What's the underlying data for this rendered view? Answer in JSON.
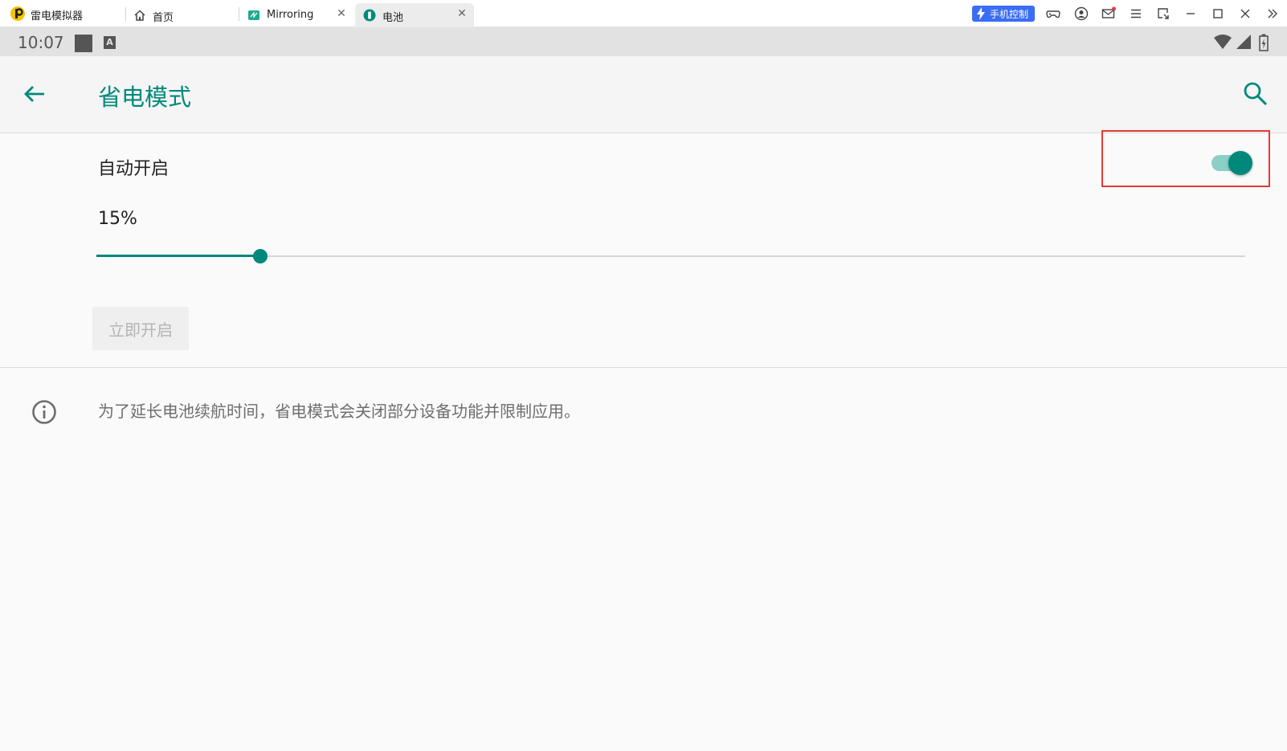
{
  "titlebar": {
    "app_name": "雷电模拟器",
    "tabs": [
      {
        "label": "首页",
        "icon": "home-icon",
        "closable": false,
        "active": false
      },
      {
        "label": "Mirroring",
        "icon": "mirroring-app-icon",
        "closable": true,
        "active": false
      },
      {
        "label": "电池",
        "icon": "battery-app-icon",
        "closable": true,
        "active": true
      }
    ],
    "close_glyph": "✕",
    "phone_control_label": "手机控制",
    "accent_color": "#3b6df4"
  },
  "statusbar": {
    "time": "10:07",
    "notification_letter": "A"
  },
  "appbar": {
    "title": "省电模式"
  },
  "content": {
    "auto_on_label": "自动开启",
    "auto_on_enabled": true,
    "threshold_label": "15%",
    "threshold_fraction": 0.143,
    "turn_on_now_label": "立即开启",
    "turn_on_now_enabled": false,
    "info_text": "为了延长电池续航时间，省电模式会关闭部分设备功能并限制应用。"
  },
  "colors": {
    "accent": "#00897b",
    "highlight": "#e53935"
  }
}
